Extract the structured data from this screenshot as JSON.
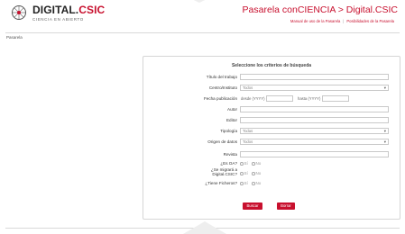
{
  "header": {
    "logo_title_main": "DIGITAL.",
    "logo_title_accent": "CSIC",
    "logo_tagline": "CIENCIA EN ABIERTO",
    "site_title": "Pasarela conCIENCIA > Digital.CSIC",
    "links": [
      "Manual de uso de la Pasarela",
      "Posibilidades de la Pasarela"
    ]
  },
  "breadcrumb": "Pasarela",
  "form": {
    "title": "Seleccione los criterios de búsqueda",
    "fields": {
      "titulo": {
        "label": "Título del trabajo",
        "value": ""
      },
      "centro": {
        "label": "Centro/Instituto",
        "value": "Todos"
      },
      "fecha": {
        "label": "Fecha publicación",
        "desde_label": "desde (YYYY)",
        "hasta_label": "hasta (YYYY)",
        "desde_value": "",
        "hasta_value": ""
      },
      "autor": {
        "label": "Autor",
        "value": ""
      },
      "editor": {
        "label": "Editor",
        "value": ""
      },
      "tipologia": {
        "label": "Tipología",
        "value": "Todas"
      },
      "origen": {
        "label": "Origen de datos",
        "value": "Todos"
      },
      "revista": {
        "label": "Revista",
        "value": ""
      },
      "oa": {
        "label": "¿Es OA?",
        "yes": "Sí",
        "no": "No"
      },
      "migrar": {
        "label_line1": "¿Se migrará a",
        "label_line2": "Digital.CSIC?",
        "yes": "Sí",
        "no": "No"
      },
      "ficheros": {
        "label": "¿Tiene Ficheros?",
        "yes": "Sí",
        "no": "No"
      }
    },
    "buttons": {
      "search": "Buscar",
      "clear": "Borrar"
    }
  },
  "colors": {
    "accent": "#c8102e",
    "border": "#d6d6d6",
    "text": "#333333"
  }
}
